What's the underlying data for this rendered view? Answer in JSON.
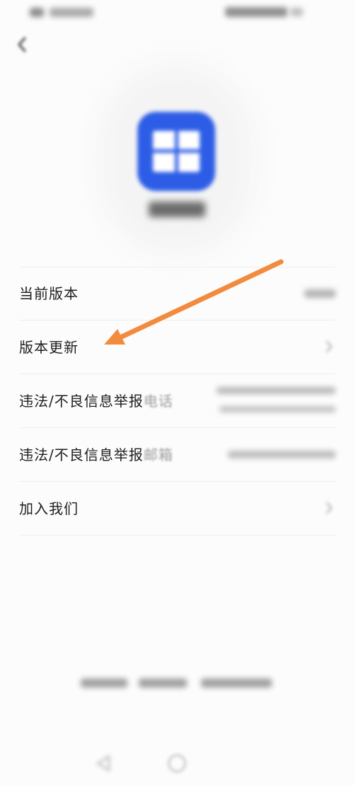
{
  "status_bar": {
    "left_icons": "status-indicators-icon",
    "right_icons": "battery-signal-icon"
  },
  "header": {
    "back_icon": "back-arrow-icon"
  },
  "app": {
    "logo_icon": "app-logo-icon",
    "logo_color": "#2D5DE6"
  },
  "settings": {
    "items": [
      {
        "label": "当前版本"
      },
      {
        "label": "版本更新",
        "trailing_icon": "chevron-right-icon"
      },
      {
        "label": "违法/不良信息举报",
        "label_faded": "电话"
      },
      {
        "label": "违法/不良信息举报",
        "label_faded": "邮箱"
      },
      {
        "label": "加入我们",
        "trailing_icon": "chevron-right-icon"
      }
    ]
  },
  "nav_bar": {
    "back_icon": "nav-back-icon",
    "home_icon": "nav-home-icon"
  },
  "annotation": {
    "arrow_icon": "arrow-pointer-icon",
    "color": "#F28B3D"
  }
}
